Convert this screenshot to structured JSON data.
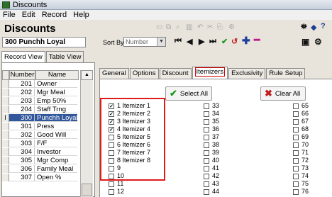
{
  "window": {
    "title": "Discounts"
  },
  "menu": [
    "File",
    "Edit",
    "Record",
    "Help"
  ],
  "header": {
    "title": "Discounts",
    "record_name": "300 Punchh Loyal"
  },
  "sort": {
    "label": "Sort By",
    "value": "Number"
  },
  "view_tabs": [
    "Record View",
    "Table View"
  ],
  "grid": {
    "columns": [
      "Number",
      "Name"
    ],
    "rows": [
      {
        "number": "201",
        "name": "Owner"
      },
      {
        "number": "202",
        "name": "Mgr Meal"
      },
      {
        "number": "203",
        "name": "Emp 50%"
      },
      {
        "number": "204",
        "name": "Staff Trng"
      },
      {
        "number": "300",
        "name": "Punchh Loyal"
      },
      {
        "number": "301",
        "name": "Press"
      },
      {
        "number": "302",
        "name": "Good Will"
      },
      {
        "number": "303",
        "name": "F/F"
      },
      {
        "number": "304",
        "name": "Investor"
      },
      {
        "number": "305",
        "name": "Mgr Comp"
      },
      {
        "number": "306",
        "name": "Family Meal"
      },
      {
        "number": "307",
        "name": "Open %"
      }
    ],
    "selected_index": 4
  },
  "tabs": [
    "General",
    "Options",
    "Discount",
    "Itemizers",
    "Exclusivity",
    "Rule Setup"
  ],
  "active_tab": "Itemizers",
  "buttons": {
    "select_all": "Select All",
    "clear_all": "Clear All"
  },
  "itemizers": {
    "col1": [
      {
        "label": "1 Itemizer 1",
        "checked": true
      },
      {
        "label": "2 Itemizer 2",
        "checked": true
      },
      {
        "label": "3 Itemizer 3",
        "checked": true
      },
      {
        "label": "4 Itemizer 4",
        "checked": true
      },
      {
        "label": "5 Itemizer 5",
        "checked": false
      },
      {
        "label": "6 Itemizer 6",
        "checked": false
      },
      {
        "label": "7 Itemizer 7",
        "checked": false
      },
      {
        "label": "8 Itemizer 8",
        "checked": false
      },
      {
        "label": "9",
        "checked": false
      },
      {
        "label": "10",
        "checked": false
      },
      {
        "label": "11",
        "checked": false
      },
      {
        "label": "12",
        "checked": false
      }
    ],
    "col2": [
      "33",
      "34",
      "35",
      "36",
      "37",
      "38",
      "39",
      "40",
      "41",
      "42",
      "43",
      "44"
    ],
    "col3": [
      "65",
      "66",
      "67",
      "68",
      "69",
      "70",
      "71",
      "72",
      "73",
      "74",
      "75",
      "76"
    ]
  }
}
